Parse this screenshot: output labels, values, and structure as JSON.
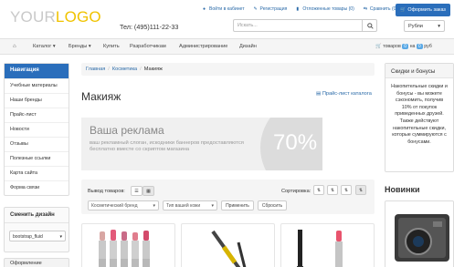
{
  "header": {
    "logo_your": "YOUR",
    "logo_logo": "LOGO",
    "phone": "Тел: (495)111-22-33",
    "links": [
      {
        "label": "Войти в кабинет",
        "icon": "user-icon"
      },
      {
        "label": "Регистрация",
        "icon": "pencil-icon"
      },
      {
        "label": "Отложенные товары (0)",
        "icon": "bookmark-icon"
      },
      {
        "label": "Сравнить (0)",
        "icon": "compare-icon"
      }
    ],
    "order_button": "Оформить заказ",
    "search_placeholder": "Искать...",
    "currency": "Рубли"
  },
  "navbar": {
    "items": [
      "Каталог",
      "Бренды",
      "Купить",
      "Разработчикам",
      "Администрирование",
      "Дизайн"
    ],
    "cart_prefix": "товаров",
    "cart_count": "0",
    "cart_on": "на",
    "cart_sum": "0",
    "cart_currency": "руб"
  },
  "sidebar": {
    "nav_title": "Навигация",
    "items": [
      "Учебные материалы",
      "Наши бренды",
      "Прайс-лист",
      "Новости",
      "Отзывы",
      "Полезные ссылки",
      "Карта сайта",
      "Форма связи"
    ],
    "design_title": "Сменить дизайн",
    "design_value": "bootstrap_fluid",
    "bottom_title": "Оформление"
  },
  "breadcrumb": {
    "items": [
      "Главная",
      "Косметика",
      "Макияж"
    ]
  },
  "main": {
    "title": "Макияж",
    "price_link": "Прайс-лист каталога",
    "banner_title": "Ваша реклама",
    "banner_text": "ваш рекламный слоган, искодники баннеров предоставляются бесплатно вместе со скриптом магазина",
    "banner_percent": "70%"
  },
  "toolbar": {
    "view_label": "Вывод товаров:",
    "sort_label": "Сортировка:",
    "filter_brand": "Косметический бренд",
    "filter_skin": "Тип вашей кожи",
    "apply": "Применить",
    "reset": "Сбросить"
  },
  "right": {
    "discount_title": "Скидки и бонусы",
    "discount_text": "Накопительные скидки и бонусы - вы можете сэкономить, получив 10% от покупок приведенных друзей. Также действуют накопительные скидки, которые суммируются с бонусами.",
    "news_title": "Новинки"
  },
  "colors": {
    "accent": "#2a6ebb",
    "link": "#2a6aa8",
    "logo_gray": "#c9c9c9",
    "logo_yellow": "#f0c300"
  }
}
